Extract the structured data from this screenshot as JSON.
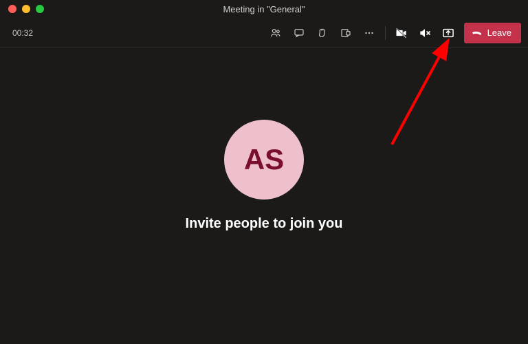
{
  "window": {
    "title": "Meeting in \"General\""
  },
  "toolbar": {
    "timer": "00:32",
    "leave_label": "Leave"
  },
  "avatar": {
    "initials": "AS"
  },
  "main": {
    "prompt": "Invite people to join you"
  },
  "annotation": {
    "target": "share-tray-button"
  }
}
